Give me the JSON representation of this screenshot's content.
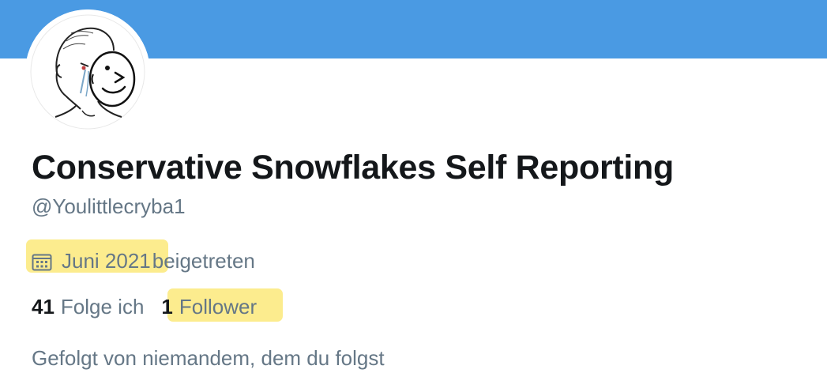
{
  "profile": {
    "display_name": "Conservative Snowflakes Self Reporting",
    "handle": "@Youlittlecryba1",
    "joined_date": "Juni 2021",
    "joined_suffix": "beigetreten",
    "following_count": "41",
    "following_label": "Folge ich",
    "followers_count": "1",
    "followers_label": "Follower",
    "followed_by_text": "Gefolgt von niemandem, dem du folgst"
  },
  "icons": {
    "joined": "calendar-icon"
  },
  "colors": {
    "banner": "#4a9ae3",
    "primary_text": "#14171a",
    "secondary_text": "#657786",
    "highlight": "#fbe97a"
  }
}
